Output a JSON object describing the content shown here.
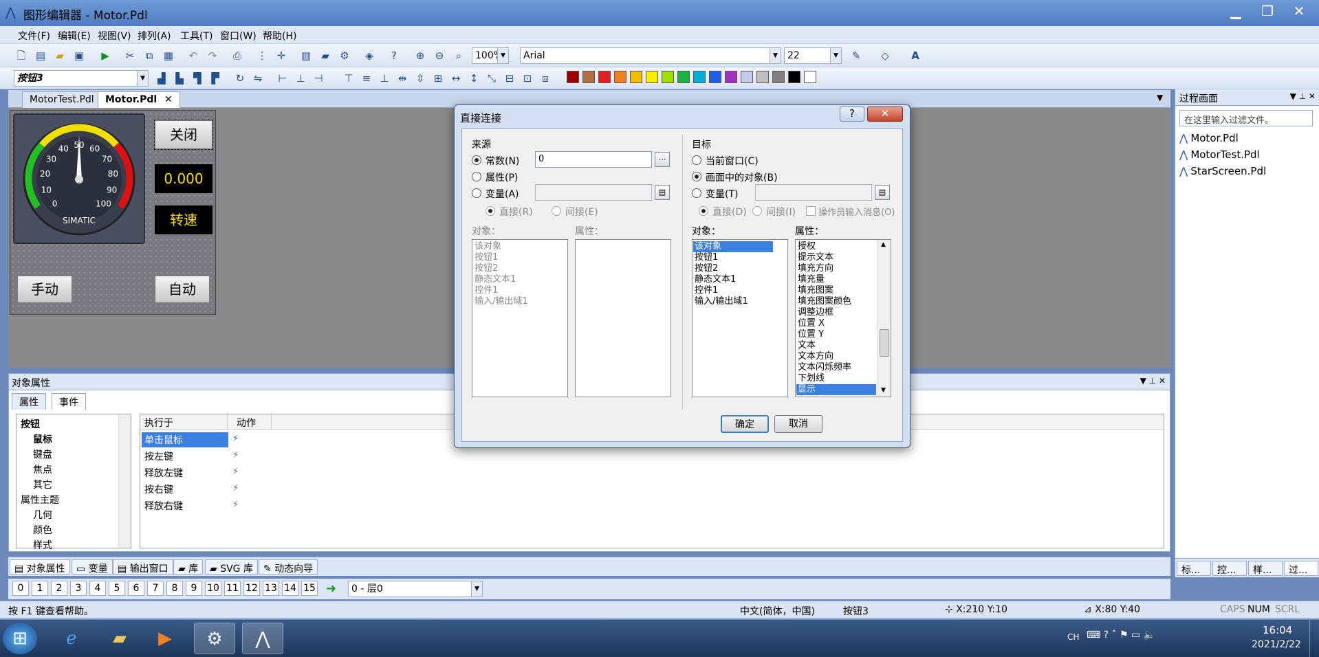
{
  "window": {
    "title": "图形编辑器 - Motor.Pdl"
  },
  "menu": [
    "文件(F)",
    "编辑(E)",
    "视图(V)",
    "排列(A)",
    "工具(T)",
    "窗口(W)",
    "帮助(H)"
  ],
  "toolbar": {
    "zoom": "100%",
    "font": "Arial",
    "font_size": "22"
  },
  "toolbar2": {
    "object_name": "按钮3"
  },
  "colors": [
    "#a00000",
    "#b07048",
    "#e02020",
    "#f08020",
    "#f0c000",
    "#f8f000",
    "#a0e000",
    "#20b040",
    "#00b0d0",
    "#2060e0",
    "#a030c0",
    "#c8c8e8",
    "#c0c0c0",
    "#808080",
    "#000000",
    "#ffffff"
  ],
  "tabs": [
    "MotorTest.Pdl",
    "Motor.Pdl"
  ],
  "screen": {
    "btn_close": "关闭",
    "value": "0.000",
    "speed_label": "转速",
    "btn_manual": "手动",
    "btn_auto": "自动",
    "gauge_brand": "SIMATIC",
    "gauge_ticks": [
      "0",
      "10",
      "20",
      "30",
      "40",
      "50",
      "60",
      "70",
      "80",
      "90",
      "100"
    ]
  },
  "right_panel": {
    "title": "过程画面",
    "filter_placeholder": "在这里输入过滤文件。",
    "files": [
      "Motor.Pdl",
      "MotorTest.Pdl",
      "StarScreen.Pdl"
    ],
    "bottom_tabs": [
      "标...",
      "控...",
      "样...",
      "过..."
    ]
  },
  "object_properties": {
    "title": "对象属性",
    "tabs": [
      "属性",
      "事件"
    ],
    "tree": [
      {
        "label": "按钮",
        "level": 0,
        "bold": true
      },
      {
        "label": "鼠标",
        "level": 1,
        "bold": true
      },
      {
        "label": "键盘",
        "level": 1
      },
      {
        "label": "焦点",
        "level": 1
      },
      {
        "label": "其它",
        "level": 1
      },
      {
        "label": "属性主题",
        "level": 0
      },
      {
        "label": "几何",
        "level": 1
      },
      {
        "label": "颜色",
        "level": 1
      },
      {
        "label": "样式",
        "level": 1
      }
    ],
    "columns": [
      "执行于",
      "动作"
    ],
    "events": [
      "单击鼠标",
      "按左键",
      "释放左键",
      "按右键",
      "释放右键"
    ]
  },
  "dock_tabs": [
    "对象属性",
    "变量",
    "输出窗口",
    "库",
    "SVG 库",
    "动态向导"
  ],
  "layers": {
    "numbers": [
      "0",
      "1",
      "2",
      "3",
      "4",
      "5",
      "6",
      "7",
      "8",
      "9",
      "10",
      "11",
      "12",
      "13",
      "14",
      "15"
    ],
    "current": "0 - 层0"
  },
  "status": {
    "help": "按 F1 键查看帮助。",
    "ime": "中文(简体，中国)",
    "object": "按钮3",
    "pos1": "X:210 Y:10",
    "pos2": "X:80 Y:40",
    "caps": "CAPS",
    "num": "NUM",
    "scrl": "SCRL"
  },
  "taskbar": {
    "lang": "CH",
    "time": "16:04",
    "date": "2021/2/22"
  },
  "dialog": {
    "title": "直接连接",
    "help": "?",
    "close": "✕",
    "source": {
      "title": "来源",
      "opt_constant": "常数(N)",
      "opt_property": "属性(P)",
      "opt_variable": "变量(A)",
      "constant_value": "0",
      "opt_direct": "直接(R)",
      "opt_indirect": "间接(E)",
      "objects_label": "对象：",
      "props_label": "属性：",
      "objects": [
        "该对象",
        "按钮1",
        "按钮2",
        "静态文本1",
        "控件1",
        "输入/输出域1"
      ]
    },
    "target": {
      "title": "目标",
      "opt_current_window": "当前窗口(C)",
      "opt_object_in_screen": "画面中的对象(B)",
      "opt_variable": "变量(T)",
      "opt_direct": "直接(D)",
      "opt_indirect": "间接(I)",
      "opt_operator_msg": "操作员输入消息(O)",
      "objects_label": "对象：",
      "props_label": "属性：",
      "objects": [
        "该对象",
        "按钮1",
        "按钮2",
        "静态文本1",
        "控件1",
        "输入/输出域1"
      ],
      "props": [
        "授权",
        "提示文本",
        "填充方向",
        "填充量",
        "填充图案",
        "填充图案颜色",
        "调整边框",
        "位置 X",
        "位置 Y",
        "文本",
        "文本方向",
        "文本闪烁频率",
        "下划线",
        "显示"
      ]
    },
    "ok": "确定",
    "cancel": "取消"
  }
}
